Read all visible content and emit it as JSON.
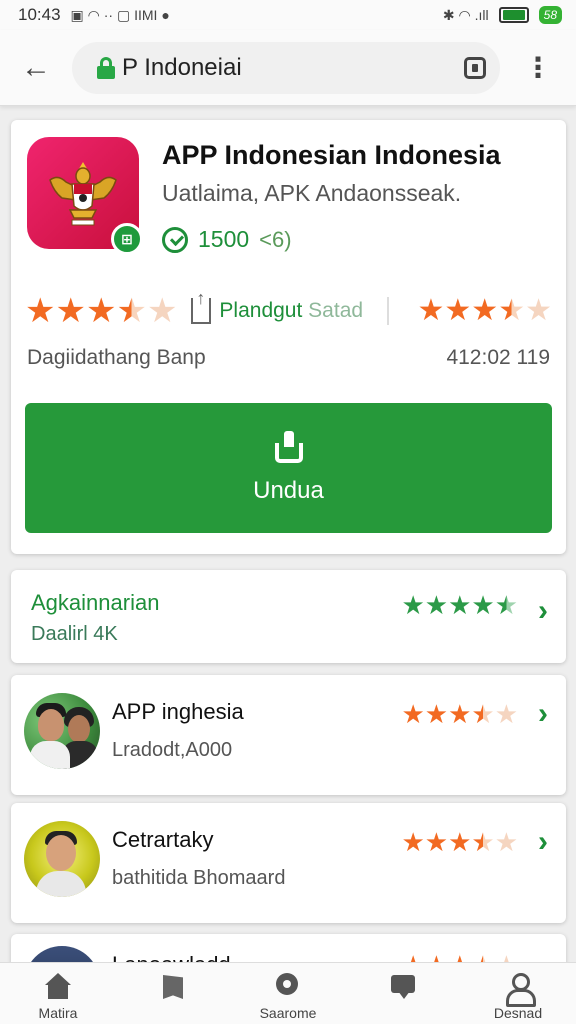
{
  "statusbar": {
    "time": "10:43",
    "left_glyphs": "▣ ◠ ·· ▢ IIMI ●",
    "right_glyphs": "✱ ◠ .ıll",
    "battery_pct": "58"
  },
  "toolbar": {
    "url": "P Indoneiai"
  },
  "app": {
    "title": "APP Indonesian Indonesia",
    "subtitle": "Uatlaima, APK Andaonsseak.",
    "count": "1500",
    "count_extra": "<6)",
    "rating": 3.5,
    "share_label": "Plandgut",
    "share_label_muted": "Satad",
    "right_rating": 3.5,
    "meta_left": "Dagiidathang Banp",
    "meta_right": "412:02 119",
    "download_label": "Undua"
  },
  "category": {
    "title": "Agkainnarian",
    "subtitle": "Daalirl 4K",
    "rating": 4.5
  },
  "items": [
    {
      "title": "APP inghesia",
      "subtitle": "Lradodt,A000",
      "rating": 3.5
    },
    {
      "title": "Cetrartaky",
      "subtitle": "bathitida Bhomaard",
      "rating": 3.5
    },
    {
      "title": "Lanoawladd",
      "subtitle": "",
      "rating": 3.5
    }
  ],
  "bottomnav": [
    {
      "label": "Matira",
      "icon": "home-icon"
    },
    {
      "label": "",
      "icon": "bookmark-icon"
    },
    {
      "label": "Saarome",
      "icon": "search-icon"
    },
    {
      "label": "",
      "icon": "chat-icon"
    },
    {
      "label": "Desnad",
      "icon": "user-icon"
    }
  ],
  "colors": {
    "primary_green": "#26993a",
    "star_orange": "#f26a22",
    "icon_red": "#e0194f"
  }
}
